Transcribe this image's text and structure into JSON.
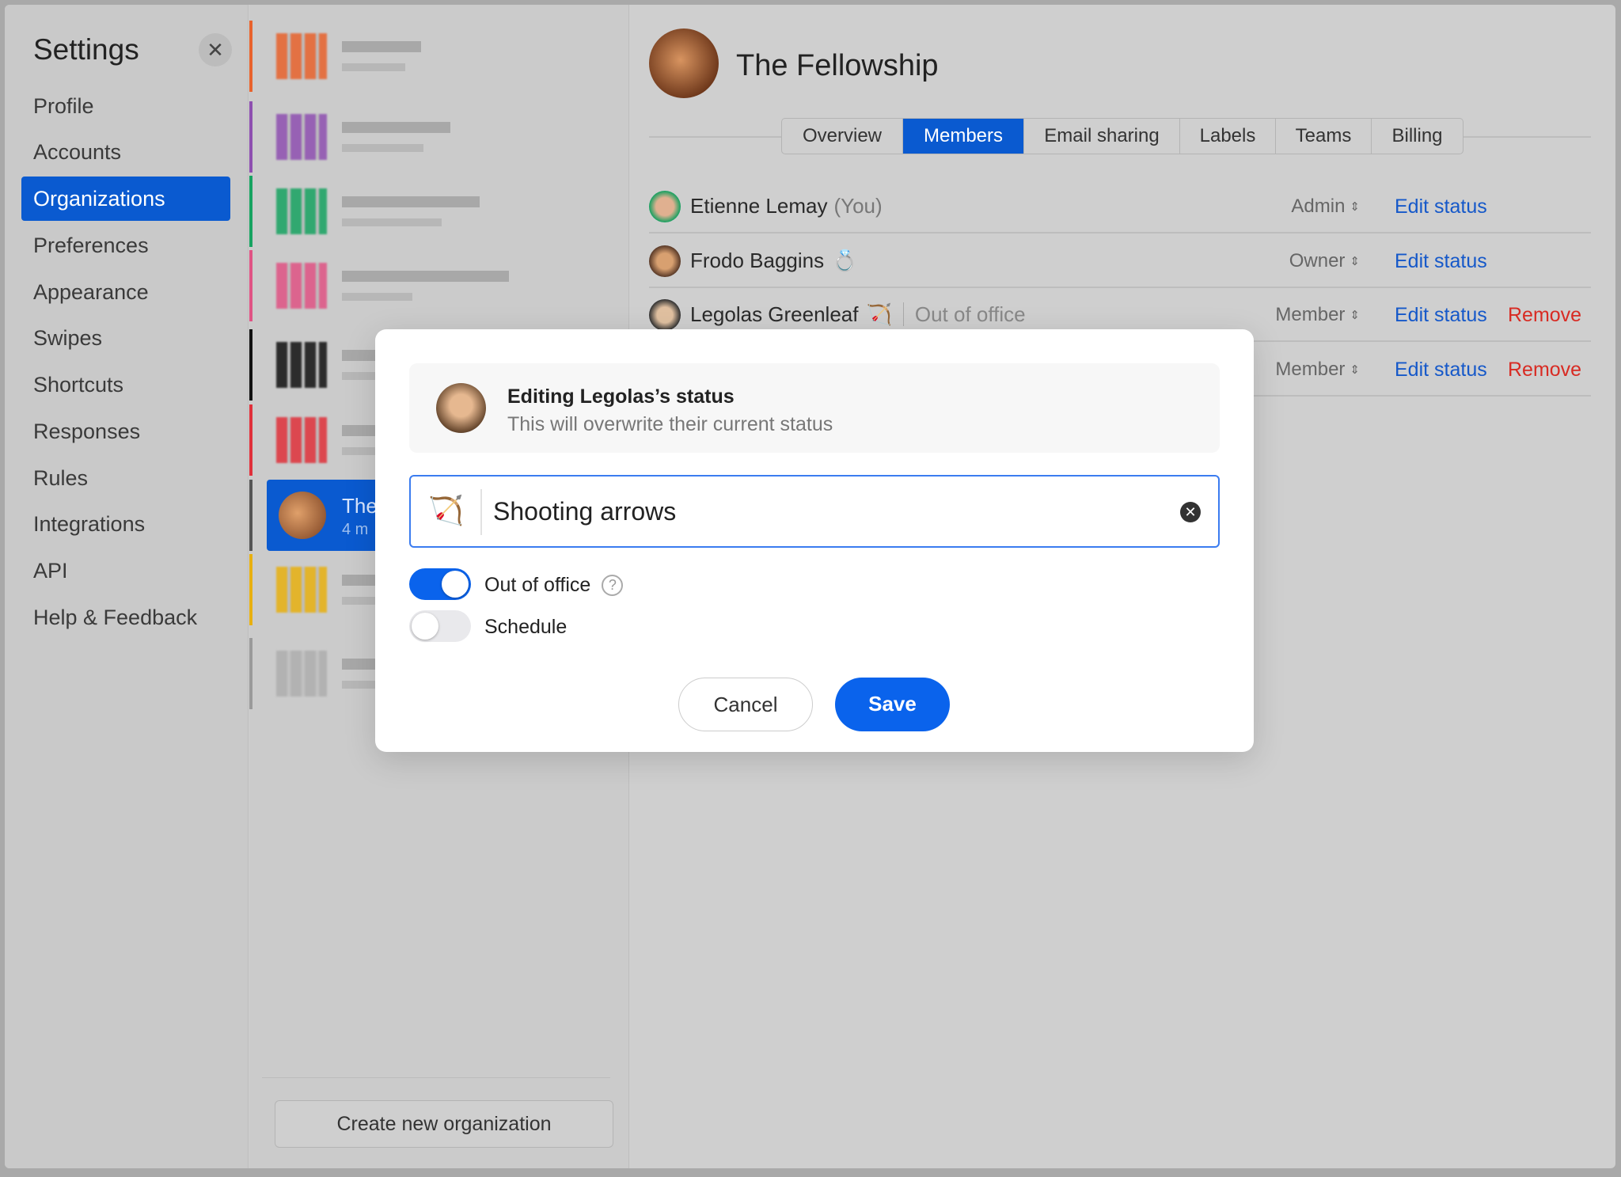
{
  "sidebar": {
    "title": "Settings",
    "close_icon": "close-icon",
    "selected": "Organizations",
    "items": [
      "Profile",
      "Accounts",
      "Organizations",
      "Preferences",
      "Appearance",
      "Swipes",
      "Shortcuts",
      "Responses",
      "Rules",
      "Integrations",
      "API",
      "Help & Feedback"
    ]
  },
  "org_list": {
    "colors": [
      "#e8622c",
      "#8e4fb0",
      "#17a361",
      "#e05384",
      "#111111",
      "#e0303a",
      "#555555",
      "#e8b010",
      "#9a9a9a"
    ],
    "selected": {
      "name": "The",
      "subtitle": "4 m"
    },
    "create_label": "Create new organization"
  },
  "org": {
    "title": "The Fellowship",
    "tabs": [
      "Overview",
      "Members",
      "Email sharing",
      "Labels",
      "Teams",
      "Billing"
    ],
    "active_tab": "Members",
    "members": [
      {
        "name": "Etienne Lemay",
        "you": "(You)",
        "emoji": "",
        "status": "",
        "role": "Admin",
        "edit": "Edit status",
        "remove": ""
      },
      {
        "name": "Frodo Baggins",
        "you": "",
        "emoji": "💍",
        "status": "",
        "role": "Owner",
        "edit": "Edit status",
        "remove": ""
      },
      {
        "name": "Legolas Greenleaf",
        "you": "",
        "emoji": "🏹",
        "status": "Out of office",
        "role": "Member",
        "edit": "Edit status",
        "remove": "Remove"
      },
      {
        "name": "",
        "you": "",
        "emoji": "",
        "status": "",
        "role": "Member",
        "edit": "Edit status",
        "remove": "Remove"
      }
    ]
  },
  "modal": {
    "title": "Editing Legolas’s status",
    "subtitle": "This will overwrite their current status",
    "emoji": "🏹",
    "status_value": "Shooting arrows",
    "out_of_office": {
      "label": "Out of office",
      "on": true
    },
    "schedule": {
      "label": "Schedule",
      "on": false
    },
    "cancel": "Cancel",
    "save": "Save",
    "accent": "#0a63ec"
  }
}
